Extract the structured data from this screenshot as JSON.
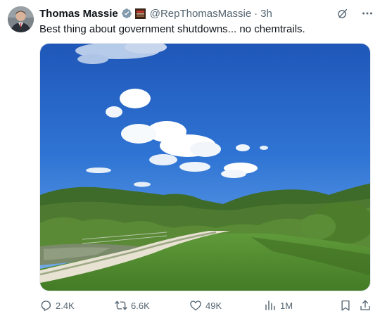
{
  "post": {
    "author_name": "Thomas Massie",
    "handle": "@RepThomasMassie",
    "separator": "·",
    "time": "3h",
    "text": "Best thing about government shutdowns... no chemtrails."
  },
  "actions": {
    "replies": "2.4K",
    "reposts": "6.6K",
    "likes": "49K",
    "views": "1M"
  },
  "icons": {
    "verified": "verified-badge-icon",
    "affiliation": "affiliation-badge-icon",
    "grok": "grok-icon",
    "more": "more-icon",
    "reply": "reply-icon",
    "repost": "repost-icon",
    "like": "like-icon",
    "views": "views-icon",
    "bookmark": "bookmark-icon",
    "share": "share-icon"
  },
  "colors": {
    "text_primary": "#0f1419",
    "text_secondary": "#536471",
    "verified_badge": "#829aab"
  }
}
